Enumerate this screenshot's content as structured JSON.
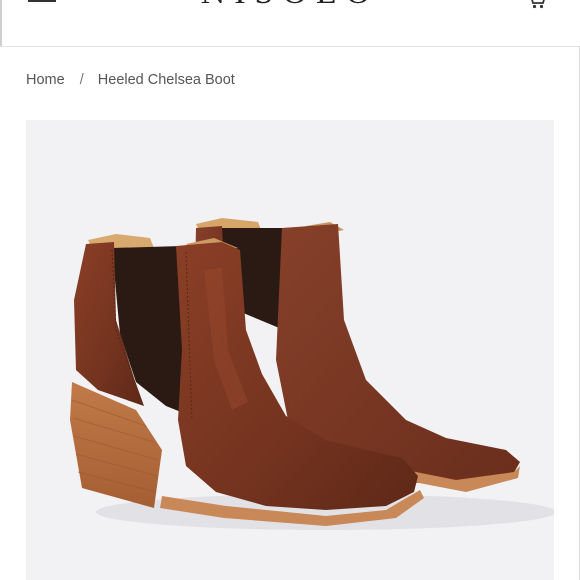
{
  "header": {
    "logo": "NISOLO",
    "menu_icon": "hamburger-menu-icon",
    "cart_icon": "cart-icon"
  },
  "breadcrumb": {
    "home": "Home",
    "separator": "/",
    "current": "Heeled Chelsea Boot"
  },
  "product": {
    "image_subject": "pair of brown leather heeled chelsea boots with dark elastic side panels and stacked wooden heels",
    "colors": {
      "leather": "#7a3621",
      "elastic": "#2b1a14",
      "heel": "#b46b3c",
      "background": "#f2f2f4"
    }
  }
}
